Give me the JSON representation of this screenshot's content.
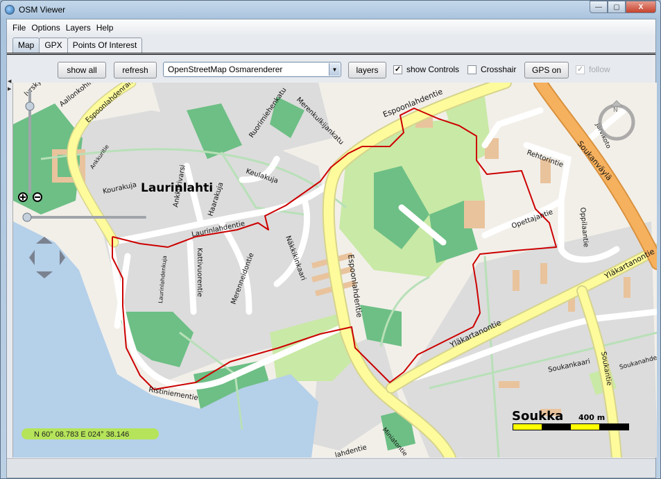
{
  "window": {
    "title": "OSM Viewer",
    "minimize": "—",
    "maximize": "▢",
    "close": "X"
  },
  "menu": [
    "File",
    "Options",
    "Layers",
    "Help"
  ],
  "tabs": [
    {
      "label": "Map",
      "active": true
    },
    {
      "label": "GPX",
      "active": false
    },
    {
      "label": "Points Of Interest",
      "active": false
    }
  ],
  "toolbar": {
    "show_all": "show all",
    "refresh": "refresh",
    "renderer": "OpenStreetMap Osmarenderer",
    "layers": "layers",
    "show_controls": {
      "label": "show Controls",
      "checked": true
    },
    "crosshair": {
      "label": "Crosshair",
      "checked": false
    },
    "gps": "GPS on",
    "follow": {
      "label": "follow",
      "checked": true,
      "enabled": false
    }
  },
  "map": {
    "place_labels": {
      "laurinlahti": "Laurinlahti",
      "soukka": "Soukka"
    },
    "streets": {
      "aallonkohina": "Aallonkohina",
      "espoonlahdenranta": "Espoonlahdenranta",
      "ankkuritie": "Ankkuritie",
      "kourakuja": "Kourakuja",
      "ankkurivarsi": "Ankkurivarsi",
      "haarakuja": "Haarakuja",
      "keulakuja": "Keulakuja",
      "ruorimiehenkatu": "Ruorimiehenkatu",
      "merenkulkijankatu": "Merenkulkijankatu",
      "espoonlahdentie_n": "Espoonlahdentie",
      "espoonlahdentie_s": "Espoonlahdentie",
      "laurinlahdentie": "Laurinlahdentie",
      "kattivuorentie": "Kattivuorentie",
      "merenneidontie": "Merenneidontie",
      "nakkikinkaari": "Näkkikinkaari",
      "laurinlahdenkuja": "Laurinlahdenkuja",
      "ristiniementie": "Ristiniementie",
      "rehtorintie": "Rehtorintie",
      "soukanvayla": "Soukanväylä",
      "jarvikoto": "Järvikoto",
      "opettajantie": "Opettajantie",
      "oppilaantie": "Oppilaantie",
      "ylakartanontie_e": "Yläkartanontie",
      "ylakartanontie_w": "Yläkartanontie",
      "soukankaari": "Soukankaari",
      "soukantie": "Soukantie",
      "soukanahde": "Soukanahde",
      "miniatontie": "Miniatontie",
      "lahdentie": "lahdentie",
      "lyrskyvuori": "lyrskyvuori"
    },
    "coordinates": "N 60° 08.783   E 024° 38.146",
    "scale_label": "400 m",
    "compass_label": "N",
    "track_color": "#cc0000",
    "colors": {
      "land": "#f2efe9",
      "residential": "#dcdcdc",
      "water": "#b5d0e9",
      "park": "#c9e9a6",
      "forest": "#6dbf85",
      "primary": "#fdfb9b",
      "trunk": "#f6b15e",
      "building": "#e9c39c",
      "path": "#b8e0b8"
    }
  }
}
